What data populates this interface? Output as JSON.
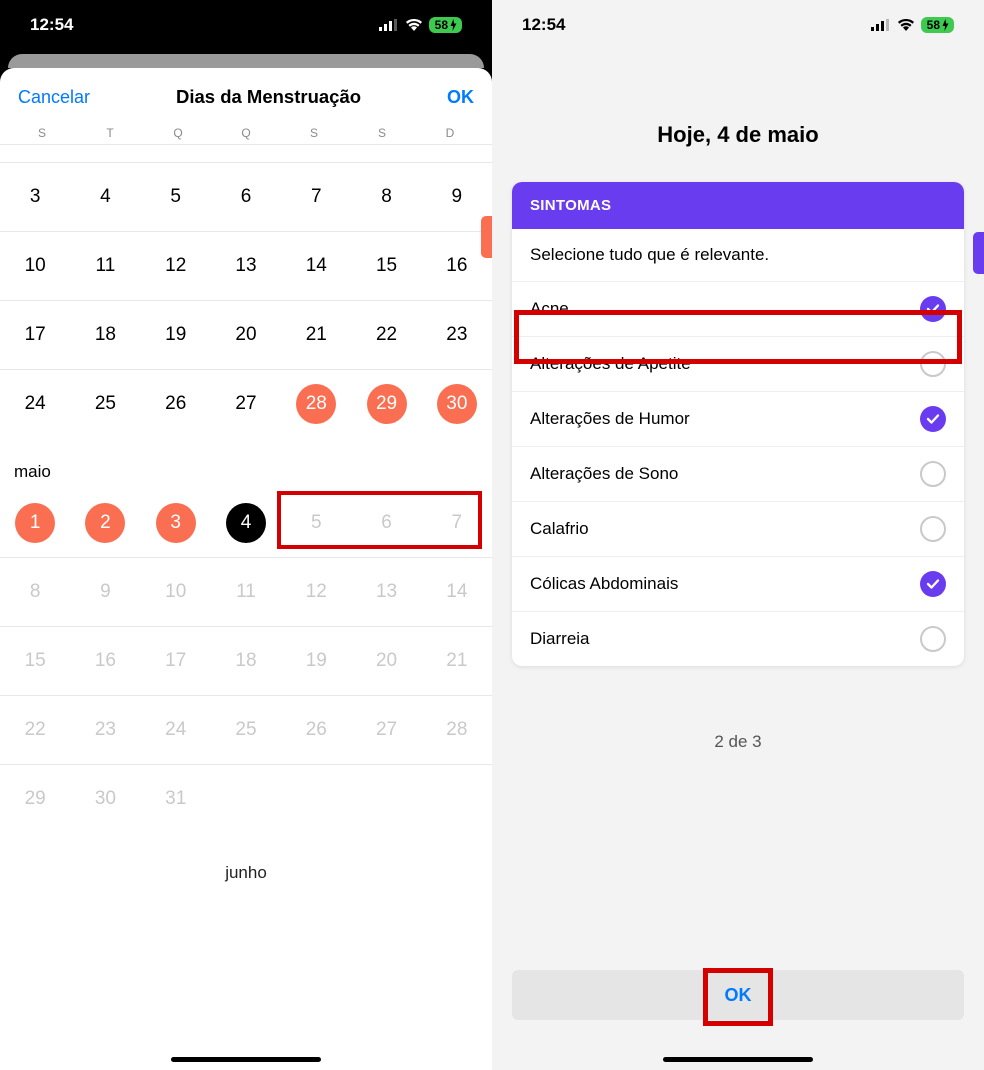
{
  "status": {
    "time": "12:54",
    "battery": "58"
  },
  "left": {
    "cancel": "Cancelar",
    "title": "Dias da Menstruação",
    "ok": "OK",
    "dow": [
      "S",
      "T",
      "Q",
      "Q",
      "S",
      "S",
      "D"
    ],
    "rows": [
      [
        "",
        "",
        "",
        "",
        "",
        "",
        ""
      ],
      [
        "3",
        "4",
        "5",
        "6",
        "7",
        "8",
        "9"
      ],
      [
        "10",
        "11",
        "12",
        "13",
        "14",
        "15",
        "16"
      ],
      [
        "17",
        "18",
        "19",
        "20",
        "21",
        "22",
        "23"
      ],
      [
        "24",
        "25",
        "26",
        "27",
        "28",
        "29",
        "30"
      ]
    ],
    "month2": "maio",
    "may_rows": [
      [
        "1",
        "2",
        "3",
        "4",
        "5",
        "6",
        "7"
      ],
      [
        "8",
        "9",
        "10",
        "11",
        "12",
        "13",
        "14"
      ],
      [
        "15",
        "16",
        "17",
        "18",
        "19",
        "20",
        "21"
      ],
      [
        "22",
        "23",
        "24",
        "25",
        "26",
        "27",
        "28"
      ],
      [
        "29",
        "30",
        "31",
        "",
        "",
        "",
        ""
      ]
    ],
    "month3": "junho"
  },
  "right": {
    "title": "Hoje, 4 de maio",
    "card_header": "SINTOMAS",
    "card_sub": "Selecione tudo que é relevante.",
    "symptoms": [
      {
        "label": "Acne",
        "checked": true
      },
      {
        "label": "Alterações de Apetite",
        "checked": false
      },
      {
        "label": "Alterações de Humor",
        "checked": true
      },
      {
        "label": "Alterações de Sono",
        "checked": false
      },
      {
        "label": "Calafrio",
        "checked": false
      },
      {
        "label": "Cólicas Abdominais",
        "checked": true
      },
      {
        "label": "Diarreia",
        "checked": false
      }
    ],
    "pager": "2 de 3",
    "ok": "OK"
  },
  "colors": {
    "accent_period": "#fa6e51",
    "accent_purple": "#6a3cf0",
    "ios_blue": "#007aff",
    "highlight": "#d40000"
  }
}
